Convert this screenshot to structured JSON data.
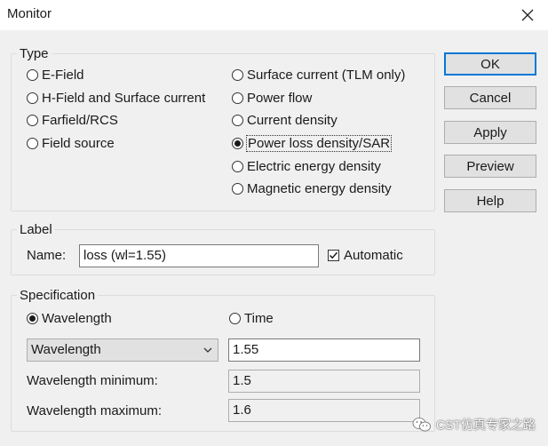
{
  "window": {
    "title": "Monitor"
  },
  "type_group": {
    "legend": "Type",
    "left_options": [
      "E-Field",
      "H-Field and Surface current",
      "Farfield/RCS",
      "Field source"
    ],
    "right_options": [
      "Surface current (TLM only)",
      "Power flow",
      "Current density",
      "Power loss density/SAR",
      "Electric energy density",
      "Magnetic energy density"
    ],
    "selected": "Power loss density/SAR"
  },
  "label_group": {
    "legend": "Label",
    "name_label": "Name:",
    "name_value": "loss (wl=1.55)",
    "automatic_label": "Automatic",
    "automatic_checked": true
  },
  "spec_group": {
    "legend": "Specification",
    "wavelength_radio": "Wavelength",
    "time_radio": "Time",
    "selected": "Wavelength",
    "mode_select": "Wavelength",
    "value": "1.55",
    "min_label": "Wavelength minimum:",
    "min_value": "1.5",
    "max_label": "Wavelength maximum:",
    "max_value": "1.6"
  },
  "buttons": {
    "ok": "OK",
    "cancel": "Cancel",
    "apply": "Apply",
    "preview": "Preview",
    "help": "Help"
  },
  "watermark": {
    "text": "CST仿真专家之路"
  }
}
